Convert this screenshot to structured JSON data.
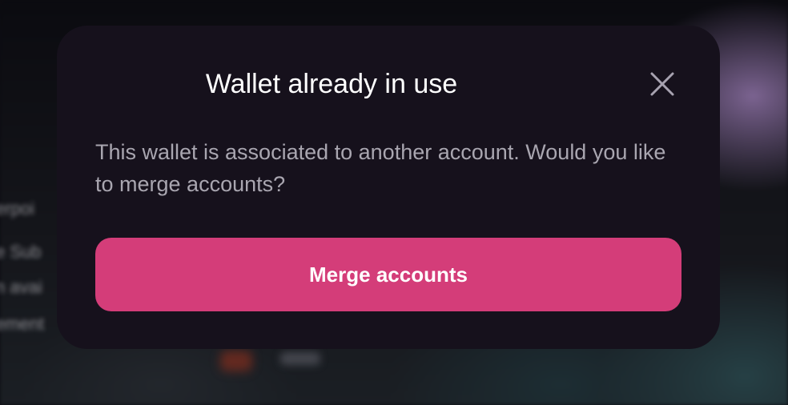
{
  "background": {
    "blurred_text_lines": [
      "erpoi",
      "e Sub",
      "n avai",
      "ement"
    ]
  },
  "modal": {
    "title": "Wallet already in use",
    "message": "This wallet is associated to another account. Would you like to merge accounts?",
    "close_icon": "close-icon",
    "primary_button_label": "Merge accounts",
    "colors": {
      "modal_background": "#16111c",
      "title": "#ffffff",
      "message": "#a9a6b0",
      "accent": "#d43d79",
      "close_icon": "#a7a2b0"
    }
  }
}
